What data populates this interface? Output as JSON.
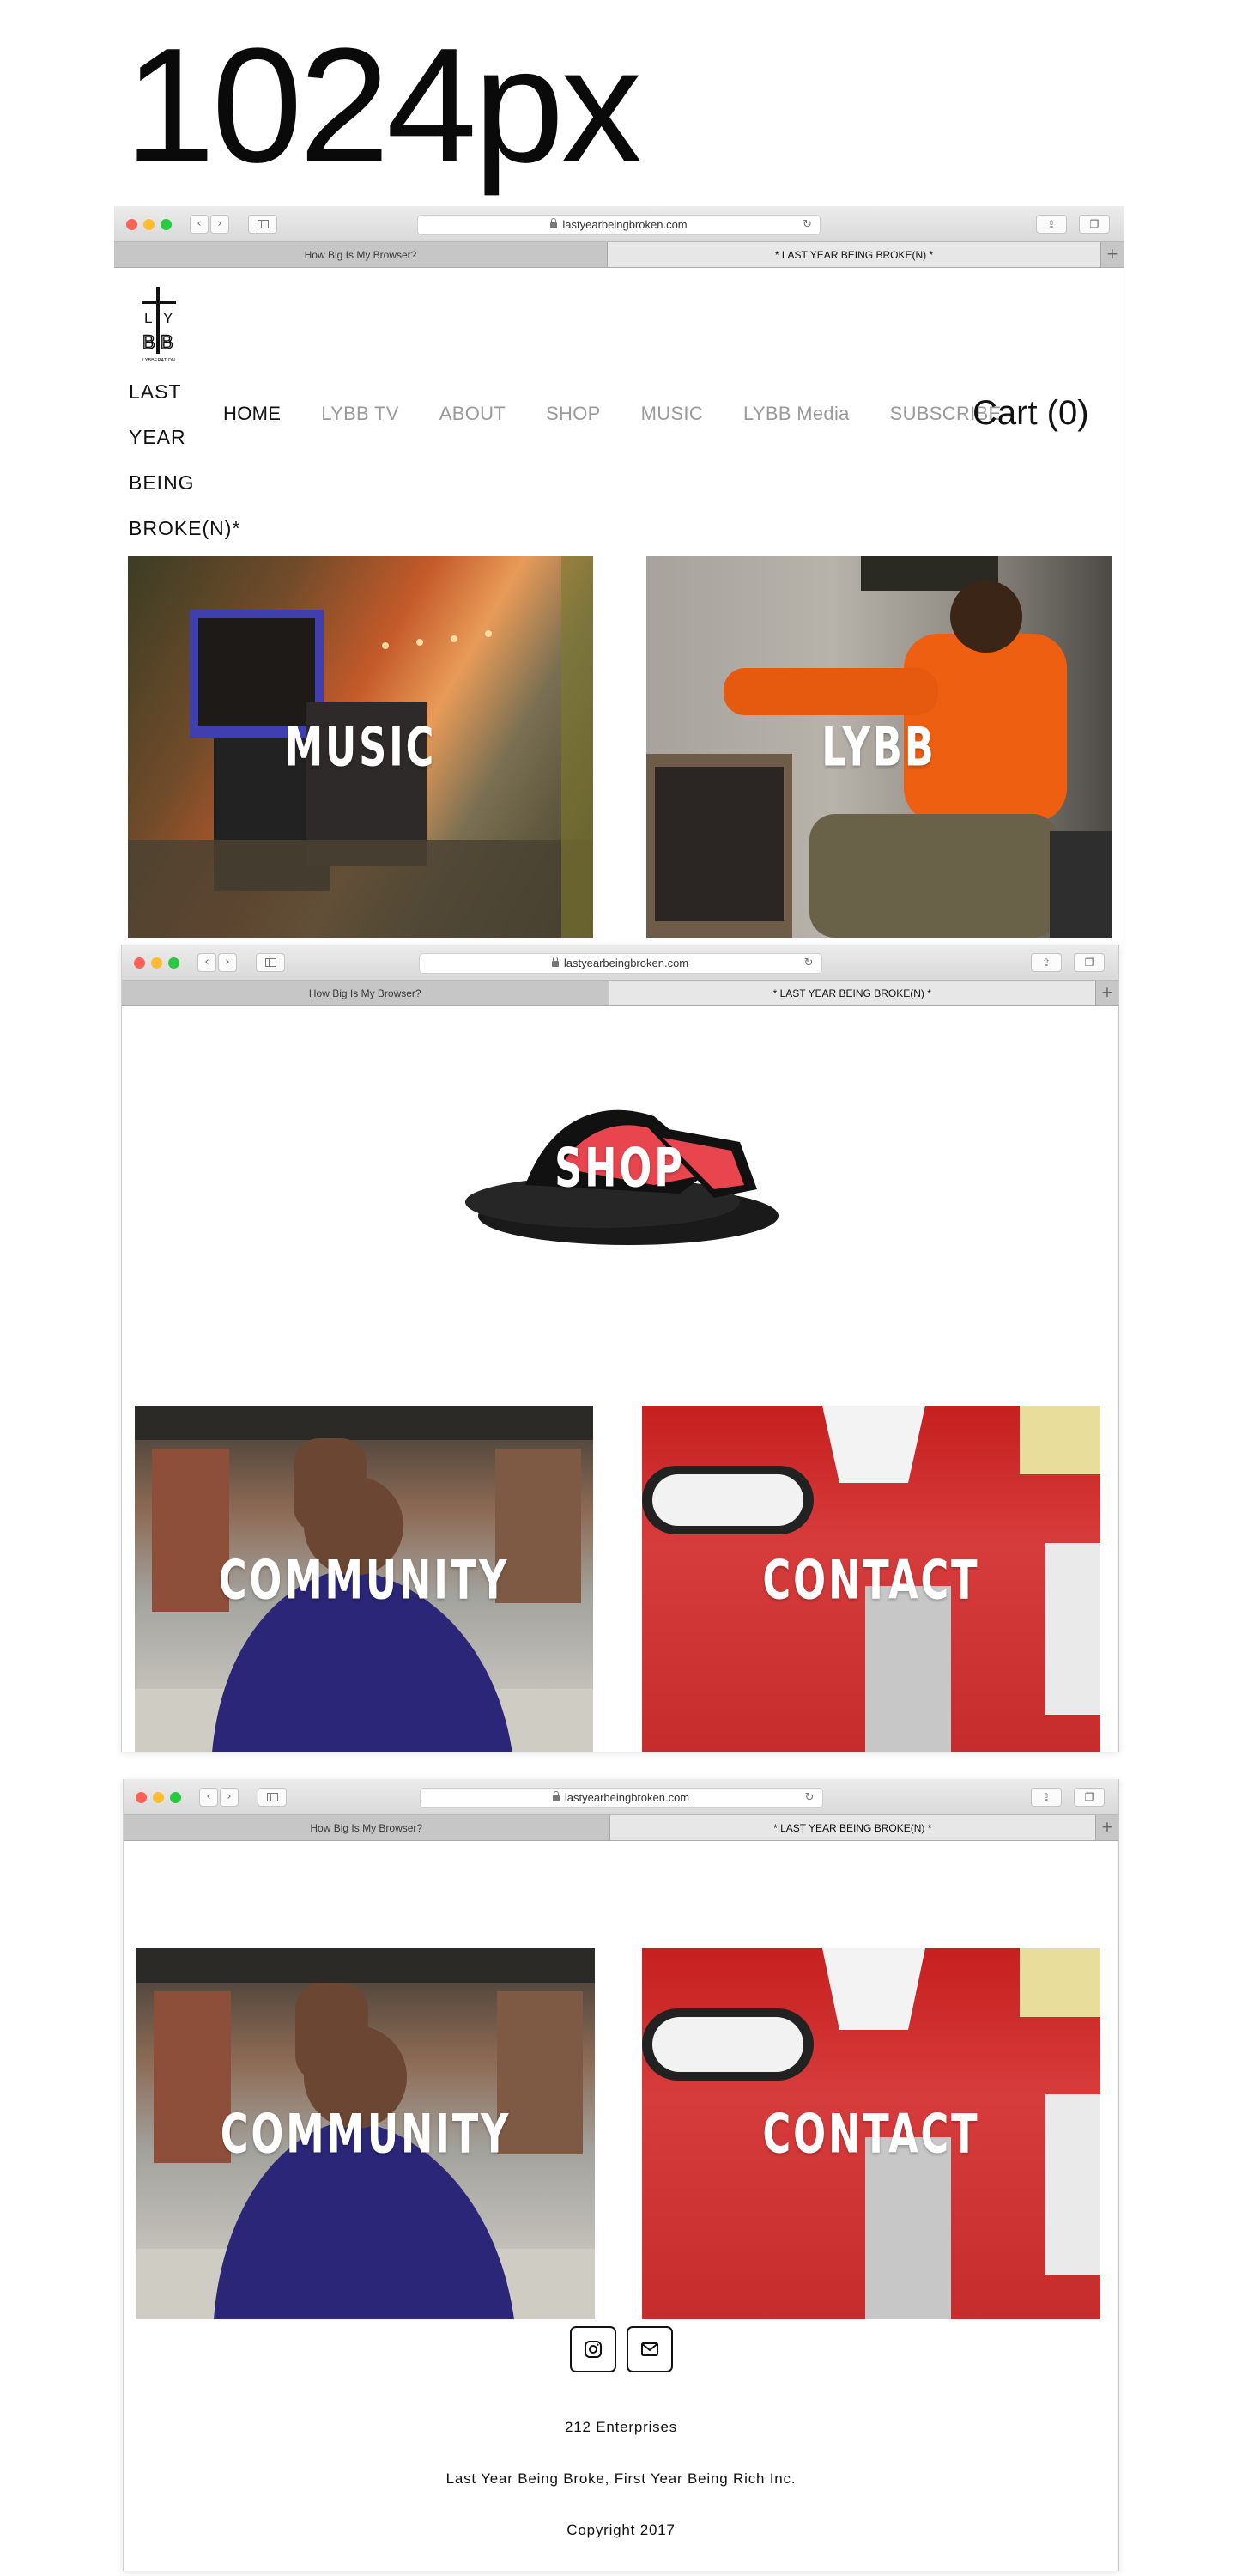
{
  "screen_label": "1024px",
  "browser": {
    "url": "lastyearbeingbroken.com",
    "tabs": [
      {
        "title": "How Big Is My Browser?"
      },
      {
        "title": "* LAST YEAR BEING BROKE(N) *"
      }
    ]
  },
  "site": {
    "logo_letters": "LYBB",
    "logo_caption": "LYBBERATION",
    "name_lines": [
      "LAST",
      "YEAR",
      "BEING",
      "BROKE(N)*"
    ],
    "nav": [
      {
        "label": "HOME"
      },
      {
        "label": "LYBB TV"
      },
      {
        "label": "ABOUT"
      },
      {
        "label": "SHOP"
      },
      {
        "label": "MUSIC"
      },
      {
        "label": "LYBB Media"
      },
      {
        "label": "SUBSCRIBE"
      }
    ],
    "cart_label": "Cart (0)"
  },
  "tiles": {
    "music": "MUSIC",
    "lybb": "LYBB",
    "shop": "SHOP",
    "community": "COMMUNITY",
    "contact": "CONTACT"
  },
  "footer": {
    "social": [
      {
        "icon": "instagram-icon"
      },
      {
        "icon": "mail-icon"
      }
    ],
    "lines": [
      "212 Enterprises",
      "Last Year Being Broke, First Year Being Rich Inc.",
      "Copyright 2017"
    ]
  },
  "colors": {
    "nav_active": "#111111",
    "nav_inactive": "#9a9a9a",
    "traffic_red": "#fe5f57",
    "traffic_yellow": "#febc2e",
    "traffic_green": "#28c840"
  }
}
